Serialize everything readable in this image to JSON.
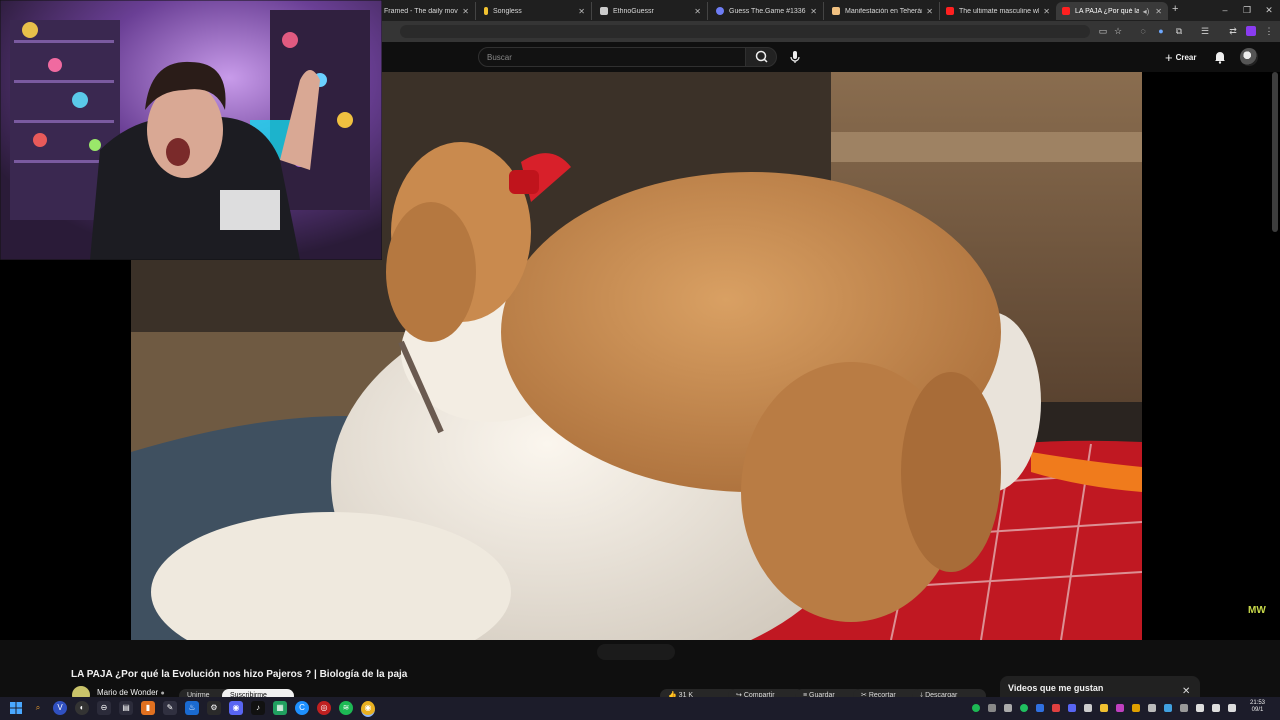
{
  "browser": {
    "tabs": [
      {
        "title": "Framed - The daily movie gu",
        "favicon_color": "#e8e8e8"
      },
      {
        "title": "Songless",
        "favicon_color": "#f2c230"
      },
      {
        "title": "EthnoGuessr",
        "favicon_color": "#cccccc"
      },
      {
        "title": "Guess The.Game #1336",
        "favicon_color": "#6e7df5"
      },
      {
        "title": "Manifestación en Teherán tra",
        "favicon_color": "#f0c080"
      },
      {
        "title": "The ultimate masculine white",
        "favicon_color": "#ff2020"
      },
      {
        "title": "LA PAJA ¿Por qué la Evolu",
        "favicon_color": "#ff2020",
        "active": true
      }
    ],
    "new_tab": "+",
    "window_controls": [
      "–",
      "❐",
      "✕"
    ]
  },
  "youtube": {
    "search_placeholder": "Buscar",
    "create_label": "Crear",
    "video_title": "LA PAJA ¿Por qué la Evolución nos hizo Pajeros ? | Biología de la paja",
    "channel_name": "Mario de Wonder",
    "join_label": "Unirme",
    "subscribe_label": "Suscribirme",
    "like_count": "31 K",
    "share_label": "Compartir",
    "save_label": "Guardar",
    "clip_label": "Recortar",
    "download_label": "Descargar",
    "watermark": "MW",
    "side_panel_title": "Videos que me gustan"
  },
  "taskbar": {
    "clock_time": "21:53",
    "clock_date": "09/1"
  },
  "colors": {
    "yt_bg": "#0f0f0f",
    "accent_red": "#ff0000",
    "watermark": "#c8d94a"
  }
}
